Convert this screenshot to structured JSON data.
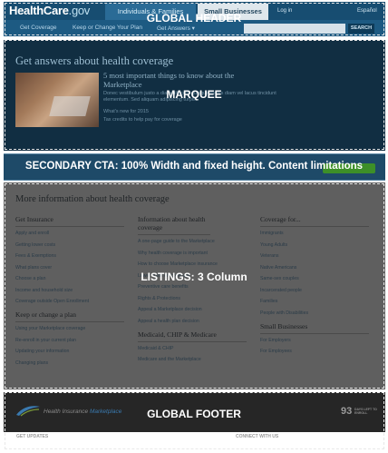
{
  "header": {
    "logo_main": "HealthCare",
    "logo_suffix": ".gov",
    "tab_individuals": "Individuals & Families",
    "tab_small_business": "Small Businesses",
    "login": "Log in",
    "espanol": "Español",
    "nav": [
      "Get Coverage",
      "Keep or Change Your Plan",
      "Get Answers ▾"
    ],
    "search_button": "SEARCH"
  },
  "marquee": {
    "title": "Get answers about health coverage",
    "headline": "5 most important things to know about the Marketplace",
    "body": "Donec vestibulum justo a diam ultrices, quisque mattis diam vel lacus tincidunt elementum. Sed aliquam adipiscing turpis.",
    "link1": "What's new for 2015",
    "link2": "Tax credits to help pay for coverage"
  },
  "listings": {
    "title": "More information about health coverage",
    "col1": {
      "heading": "Get Insurance",
      "items": [
        "Apply and enroll",
        "Getting lower costs",
        "Fees & Exemptions",
        "What plans cover",
        "Choose a plan",
        "Income and household size",
        "Coverage outside Open Enrollment"
      ],
      "heading2": "Keep or change a plan",
      "items2": [
        "Using your Marketplace coverage",
        "Re-enroll in your current plan",
        "Updating your information",
        "Changing plans"
      ]
    },
    "col2": {
      "heading": "Information about health coverage",
      "items": [
        "A one-page guide to the Marketplace",
        "Why health coverage is important",
        "How to choose Marketplace insurance",
        "Lower costs on coverage",
        "Preventive care benefits",
        "Rights & Protections",
        "Appeal a Marketplace decision",
        "Appeal a health plan decision"
      ],
      "heading2": "Medicaid, CHIP & Medicare",
      "items2": [
        "Medicaid & CHIP",
        "Medicare and the Marketplace"
      ]
    },
    "col3": {
      "heading": "Coverage for...",
      "items": [
        "Immigrants",
        "Young Adults",
        "Veterans",
        "Native Americans",
        "Same-sex couples",
        "Incarcerated people",
        "Families",
        "People with Disabilities"
      ],
      "heading2": "Small Businesses",
      "items2": [
        "For Employers",
        "For Employees"
      ]
    }
  },
  "footer": {
    "logo_text": "Health Insurance",
    "logo_mark": "Marketplace",
    "days_number": "93",
    "days_label": "DAYS LEFT TO ENROLL",
    "ext_left": "GET UPDATES",
    "ext_right": "CONNECT WITH US"
  },
  "annotations": {
    "global_header": "GLOBAL HEADER",
    "marquee": "MARQUEE",
    "secondary_cta": "SECONDARY CTA: 100% Width and fixed height. Content limitations",
    "listings": "LISTINGS: 3 Column",
    "global_footer": "GLOBAL FOOTER"
  },
  "colors": {
    "header_bg": "#174d71",
    "marquee_bg": "#112e42",
    "cta_bg": "#1e4a68",
    "cta_button": "#3d8f28",
    "listings_bg": "#5f5f5f",
    "footer_bg": "#262626"
  }
}
